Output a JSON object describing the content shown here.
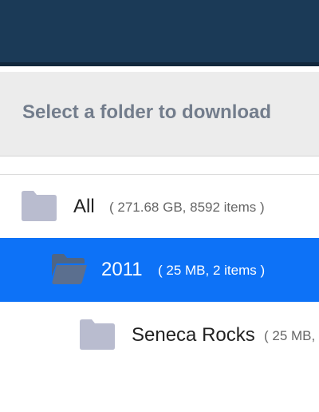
{
  "header": {
    "title": "Select a folder to download"
  },
  "folders": [
    {
      "name": "All",
      "meta": "( 271.68 GB, 8592 items )",
      "selected": false,
      "icon": "folder-icon"
    },
    {
      "name": "2011",
      "meta": "( 25 MB, 2 items )",
      "selected": true,
      "icon": "folder-open-icon"
    },
    {
      "name": "Seneca Rocks",
      "meta": "( 25 MB,",
      "selected": false,
      "icon": "folder-icon"
    }
  ],
  "colors": {
    "topbar": "#1b3a57",
    "selected_row": "#0d72f7",
    "folder_icon": "#b9bccf",
    "folder_icon_selected": "#5b6f8f"
  }
}
